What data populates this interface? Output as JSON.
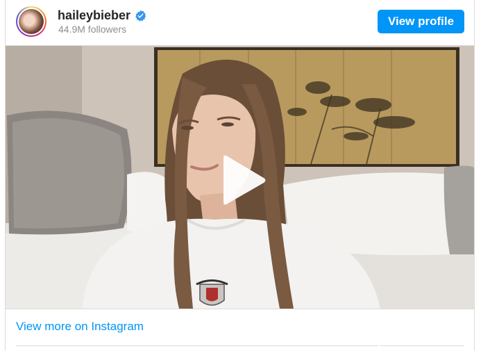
{
  "profile": {
    "username": "haileybieber",
    "followers": "44.9M followers",
    "verified": true,
    "avatar_icon": "profile-photo"
  },
  "actions": {
    "view_profile_label": "View profile",
    "view_more_label": "View more on Instagram"
  },
  "media": {
    "type": "video",
    "play_icon": "play-icon"
  },
  "colors": {
    "primary_button": "#0095f6",
    "link": "#0095f6",
    "verified_badge": "#3897f0",
    "username": "#262626",
    "secondary_text": "#8e8e8e",
    "border": "#dbdbdb"
  }
}
